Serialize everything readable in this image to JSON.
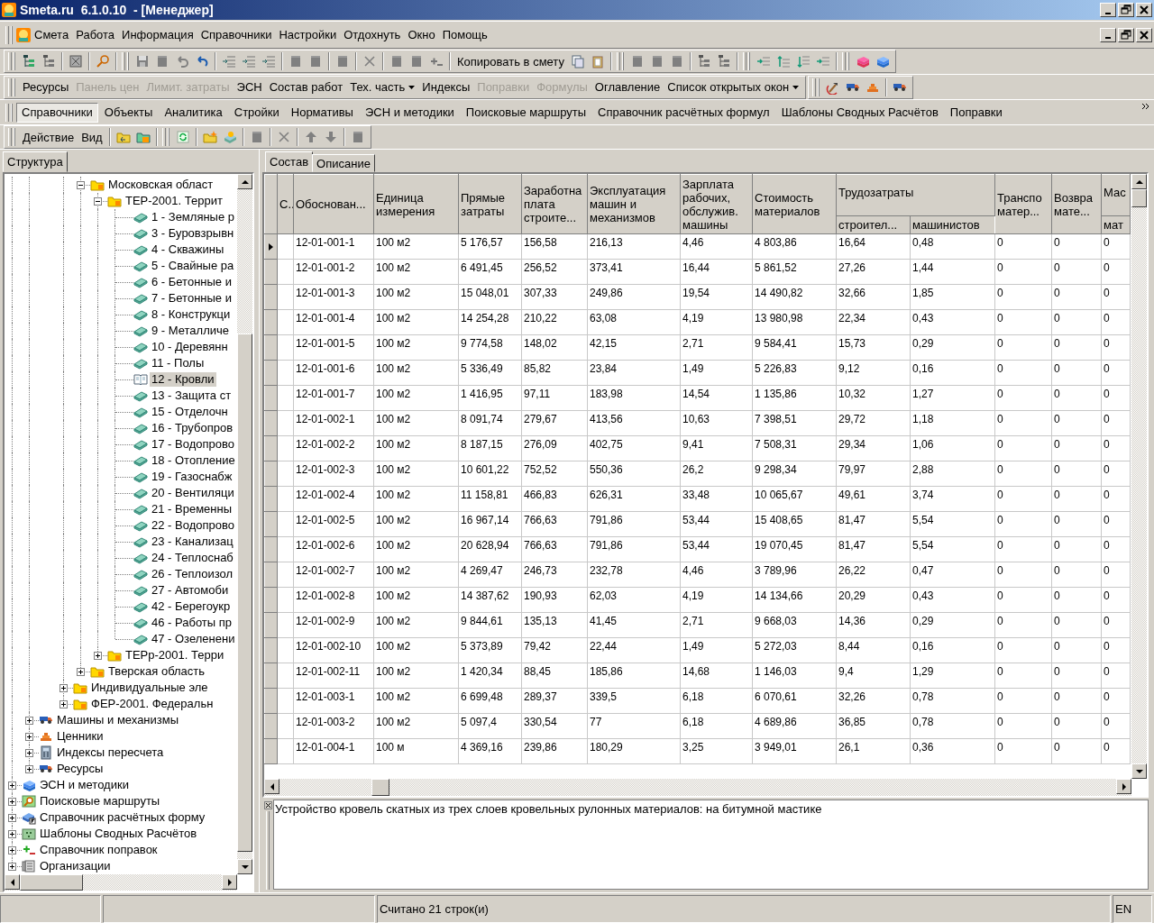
{
  "window": {
    "title": "Smeta.ru  6.1.0.10  - [Менеджер]"
  },
  "menu": [
    "Смета",
    "Работа",
    "Информация",
    "Справочники",
    "Настройки",
    "Отдохнуть",
    "Окно",
    "Помощь"
  ],
  "toolbar": {
    "copy_button": "Копировать в смету"
  },
  "panel_bar": [
    {
      "label": "Ресурсы",
      "disabled": false,
      "kind": "button"
    },
    {
      "label": "Панель цен",
      "disabled": true,
      "kind": "button"
    },
    {
      "label": "Лимит. затраты",
      "disabled": true,
      "kind": "button"
    },
    {
      "label": "ЭСН",
      "disabled": false,
      "kind": "button"
    },
    {
      "label": "Состав работ",
      "disabled": false,
      "kind": "button"
    },
    {
      "label": "Тех. часть",
      "disabled": false,
      "kind": "dropdown"
    },
    {
      "label": "Индексы",
      "disabled": false,
      "kind": "button"
    },
    {
      "label": "Поправки",
      "disabled": true,
      "kind": "button"
    },
    {
      "label": "Формулы",
      "disabled": true,
      "kind": "button"
    },
    {
      "label": "Оглавление",
      "disabled": false,
      "kind": "button"
    },
    {
      "label": "Список открытых окон",
      "disabled": false,
      "kind": "dropdown"
    }
  ],
  "section_tabs": [
    {
      "label": "Справочники",
      "selected": true
    },
    {
      "label": "Объекты",
      "selected": false
    },
    {
      "label": "Аналитика",
      "selected": false
    },
    {
      "label": "Стройки",
      "selected": false
    },
    {
      "label": "Нормативы",
      "selected": false
    },
    {
      "label": "ЭСН и методики",
      "selected": false
    },
    {
      "label": "Поисковые маршруты",
      "selected": false
    },
    {
      "label": "Справочник расчётных формул",
      "selected": false
    },
    {
      "label": "Шаблоны Сводных Расчётов",
      "selected": false
    },
    {
      "label": "Поправки",
      "selected": false
    }
  ],
  "action_menu": [
    "Действие",
    "Вид"
  ],
  "left_panel": {
    "tab": "Структура",
    "tree": [
      {
        "children": [
          {
            "children": [
              {
                "children": [
                  {
                    "children": [
                      {
                        "label": "Московская област",
                        "kind": "folder",
                        "selected": false,
                        "expanded": true,
                        "children": [
                          {
                            "label": "ТЕР-2001. Террит",
                            "kind": "folder",
                            "selected": false,
                            "expanded": true,
                            "children": [
                              {
                                "label": "1 - Земляные р",
                                "kind": "book",
                                "selected": false
                              },
                              {
                                "label": "3 - Буровзрывн",
                                "kind": "book",
                                "selected": false
                              },
                              {
                                "label": "4 - Скважины",
                                "kind": "book",
                                "selected": false
                              },
                              {
                                "label": "5 - Свайные ра",
                                "kind": "book",
                                "selected": false
                              },
                              {
                                "label": "6 - Бетонные и",
                                "kind": "book",
                                "selected": false
                              },
                              {
                                "label": "7 - Бетонные и",
                                "kind": "book",
                                "selected": false
                              },
                              {
                                "label": "8 - Конструкци",
                                "kind": "book",
                                "selected": false
                              },
                              {
                                "label": "9 - Металличе",
                                "kind": "book",
                                "selected": false
                              },
                              {
                                "label": "10 - Деревянн",
                                "kind": "book",
                                "selected": false
                              },
                              {
                                "label": "11 - Полы",
                                "kind": "book",
                                "selected": false
                              },
                              {
                                "label": "12 - Кровли",
                                "kind": "book",
                                "selected": true
                              },
                              {
                                "label": "13 - Защита ст",
                                "kind": "book",
                                "selected": false
                              },
                              {
                                "label": "15 - Отделочн",
                                "kind": "book",
                                "selected": false
                              },
                              {
                                "label": "16 - Трубопров",
                                "kind": "book",
                                "selected": false
                              },
                              {
                                "label": "17 - Водопрово",
                                "kind": "book",
                                "selected": false
                              },
                              {
                                "label": "18 - Отопление",
                                "kind": "book",
                                "selected": false
                              },
                              {
                                "label": "19 - Газоснабж",
                                "kind": "book",
                                "selected": false
                              },
                              {
                                "label": "20 - Вентиляци",
                                "kind": "book",
                                "selected": false
                              },
                              {
                                "label": "21 - Временны",
                                "kind": "book",
                                "selected": false
                              },
                              {
                                "label": "22 - Водопрово",
                                "kind": "book",
                                "selected": false
                              },
                              {
                                "label": "23 - Канализац",
                                "kind": "book",
                                "selected": false
                              },
                              {
                                "label": "24 - Теплоснаб",
                                "kind": "book",
                                "selected": false
                              },
                              {
                                "label": "26 - Теплоизол",
                                "kind": "book",
                                "selected": false
                              },
                              {
                                "label": "27 - Автомоби",
                                "kind": "book",
                                "selected": false
                              },
                              {
                                "label": "42 - Берегоукр",
                                "kind": "book",
                                "selected": false
                              },
                              {
                                "label": "46 - Работы пр",
                                "kind": "book",
                                "selected": false
                              },
                              {
                                "label": "47 - Озеленени",
                                "kind": "book",
                                "selected": false
                              }
                            ]
                          },
                          {
                            "label": "ТЕРр-2001. Терри",
                            "kind": "folder",
                            "selected": false,
                            "expanded": false
                          }
                        ]
                      },
                      {
                        "label": "Тверская область",
                        "kind": "folder",
                        "selected": false,
                        "expanded": false
                      }
                    ]
                  },
                  {
                    "label": "Индивидуальные эле",
                    "kind": "folder",
                    "selected": false,
                    "expanded": false
                  },
                  {
                    "label": "ФЕР-2001. Федеральн",
                    "kind": "folder",
                    "selected": false,
                    "expanded": false
                  }
                ]
              }
            ]
          },
          {
            "label": "Машины и механизмы",
            "kind": "truck",
            "selected": false,
            "expanded": false
          },
          {
            "label": "Ценники",
            "kind": "bricks",
            "selected": false,
            "expanded": false
          },
          {
            "label": "Индексы пересчета",
            "kind": "calculator",
            "selected": false,
            "expanded": false
          },
          {
            "label": "Ресурсы",
            "kind": "truck",
            "selected": false,
            "expanded": false
          }
        ]
      },
      {
        "label": "ЭСН и методики",
        "kind": "books",
        "selected": false,
        "expanded": false
      },
      {
        "label": "Поисковые маршруты",
        "kind": "map",
        "selected": false,
        "expanded": false
      },
      {
        "label": "Справочник расчётных форму",
        "kind": "formula",
        "selected": false,
        "expanded": false
      },
      {
        "label": "Шаблоны Сводных Расчётов",
        "kind": "template",
        "selected": false,
        "expanded": false
      },
      {
        "label": "Справочник поправок",
        "kind": "plusminus",
        "selected": false,
        "expanded": false
      },
      {
        "label": "Организации",
        "kind": "organizer",
        "selected": false,
        "expanded": false
      }
    ]
  },
  "right_panel": {
    "tabs": [
      {
        "label": "Состав",
        "selected": true
      },
      {
        "label": "Описание",
        "selected": false
      }
    ],
    "table": {
      "columns": [
        {
          "label": "С.."
        },
        {
          "label": "Обоснован..."
        },
        {
          "label": "Единица\nизмерения"
        },
        {
          "label": "Прямые\nзатраты"
        },
        {
          "label": "Заработна\nплата\nстроите..."
        },
        {
          "label": "Эксплуатация\nмашин и\nмеханизмов"
        },
        {
          "label": "Зарплата\nрабочих,\nобслужив.\nмашины"
        },
        {
          "label": "Стоимость\nматериалов"
        },
        {
          "label": "Трудозатраты",
          "colspan": 2,
          "sub": [
            "строител...",
            "машинистов"
          ]
        },
        {
          "label": "Транспо\nматер..."
        },
        {
          "label": "Возвра\nмате..."
        },
        {
          "label": "Мас",
          "sub": [
            "мат"
          ]
        }
      ],
      "rows": [
        {
          "selected": true,
          "cells": [
            "",
            "12-01-001-1",
            "100 м2",
            "5 176,57",
            "156,58",
            "216,13",
            "4,46",
            "4 803,86",
            "16,64",
            "0,48",
            "0",
            "0",
            "0"
          ]
        },
        {
          "selected": false,
          "cells": [
            "",
            "12-01-001-2",
            "100 м2",
            "6 491,45",
            "256,52",
            "373,41",
            "16,44",
            "5 861,52",
            "27,26",
            "1,44",
            "0",
            "0",
            "0"
          ]
        },
        {
          "selected": false,
          "cells": [
            "",
            "12-01-001-3",
            "100 м2",
            "15 048,01",
            "307,33",
            "249,86",
            "19,54",
            "14 490,82",
            "32,66",
            "1,85",
            "0",
            "0",
            "0"
          ]
        },
        {
          "selected": false,
          "cells": [
            "",
            "12-01-001-4",
            "100 м2",
            "14 254,28",
            "210,22",
            "63,08",
            "4,19",
            "13 980,98",
            "22,34",
            "0,43",
            "0",
            "0",
            "0"
          ]
        },
        {
          "selected": false,
          "cells": [
            "",
            "12-01-001-5",
            "100 м2",
            "9 774,58",
            "148,02",
            "42,15",
            "2,71",
            "9 584,41",
            "15,73",
            "0,29",
            "0",
            "0",
            "0"
          ]
        },
        {
          "selected": false,
          "cells": [
            "",
            "12-01-001-6",
            "100 м2",
            "5 336,49",
            "85,82",
            "23,84",
            "1,49",
            "5 226,83",
            "9,12",
            "0,16",
            "0",
            "0",
            "0"
          ]
        },
        {
          "selected": false,
          "cells": [
            "",
            "12-01-001-7",
            "100 м2",
            "1 416,95",
            "97,11",
            "183,98",
            "14,54",
            "1 135,86",
            "10,32",
            "1,27",
            "0",
            "0",
            "0"
          ]
        },
        {
          "selected": false,
          "cells": [
            "",
            "12-01-002-1",
            "100 м2",
            "8 091,74",
            "279,67",
            "413,56",
            "10,63",
            "7 398,51",
            "29,72",
            "1,18",
            "0",
            "0",
            "0"
          ]
        },
        {
          "selected": false,
          "cells": [
            "",
            "12-01-002-2",
            "100 м2",
            "8 187,15",
            "276,09",
            "402,75",
            "9,41",
            "7 508,31",
            "29,34",
            "1,06",
            "0",
            "0",
            "0"
          ]
        },
        {
          "selected": false,
          "cells": [
            "",
            "12-01-002-3",
            "100 м2",
            "10 601,22",
            "752,52",
            "550,36",
            "26,2",
            "9 298,34",
            "79,97",
            "2,88",
            "0",
            "0",
            "0"
          ]
        },
        {
          "selected": false,
          "cells": [
            "",
            "12-01-002-4",
            "100 м2",
            "11 158,81",
            "466,83",
            "626,31",
            "33,48",
            "10 065,67",
            "49,61",
            "3,74",
            "0",
            "0",
            "0"
          ]
        },
        {
          "selected": false,
          "cells": [
            "",
            "12-01-002-5",
            "100 м2",
            "16 967,14",
            "766,63",
            "791,86",
            "53,44",
            "15 408,65",
            "81,47",
            "5,54",
            "0",
            "0",
            "0"
          ]
        },
        {
          "selected": false,
          "cells": [
            "",
            "12-01-002-6",
            "100 м2",
            "20 628,94",
            "766,63",
            "791,86",
            "53,44",
            "19 070,45",
            "81,47",
            "5,54",
            "0",
            "0",
            "0"
          ]
        },
        {
          "selected": false,
          "cells": [
            "",
            "12-01-002-7",
            "100 м2",
            "4 269,47",
            "246,73",
            "232,78",
            "4,46",
            "3 789,96",
            "26,22",
            "0,47",
            "0",
            "0",
            "0"
          ]
        },
        {
          "selected": false,
          "cells": [
            "",
            "12-01-002-8",
            "100 м2",
            "14 387,62",
            "190,93",
            "62,03",
            "4,19",
            "14 134,66",
            "20,29",
            "0,43",
            "0",
            "0",
            "0"
          ]
        },
        {
          "selected": false,
          "cells": [
            "",
            "12-01-002-9",
            "100 м2",
            "9 844,61",
            "135,13",
            "41,45",
            "2,71",
            "9 668,03",
            "14,36",
            "0,29",
            "0",
            "0",
            "0"
          ]
        },
        {
          "selected": false,
          "cells": [
            "",
            "12-01-002-10",
            "100 м2",
            "5 373,89",
            "79,42",
            "22,44",
            "1,49",
            "5 272,03",
            "8,44",
            "0,16",
            "0",
            "0",
            "0"
          ]
        },
        {
          "selected": false,
          "cells": [
            "",
            "12-01-002-11",
            "100 м2",
            "1 420,34",
            "88,45",
            "185,86",
            "14,68",
            "1 146,03",
            "9,4",
            "1,29",
            "0",
            "0",
            "0"
          ]
        },
        {
          "selected": false,
          "cells": [
            "",
            "12-01-003-1",
            "100 м2",
            "6 699,48",
            "289,37",
            "339,5",
            "6,18",
            "6 070,61",
            "32,26",
            "0,78",
            "0",
            "0",
            "0"
          ]
        },
        {
          "selected": false,
          "cells": [
            "",
            "12-01-003-2",
            "100 м2",
            "5 097,4",
            "330,54",
            "77",
            "6,18",
            "4 689,86",
            "36,85",
            "0,78",
            "0",
            "0",
            "0"
          ]
        },
        {
          "selected": false,
          "cells": [
            "",
            "12-01-004-1",
            "100 м",
            "4 369,16",
            "239,86",
            "180,29",
            "3,25",
            "3 949,01",
            "26,1",
            "0,36",
            "0",
            "0",
            "0"
          ]
        }
      ]
    },
    "description": "Устройство кровель скатных из трех слоев кровельных рулонных материалов: на битумной мастике"
  },
  "status_bar": {
    "message": "Считано 21 строк(и)",
    "language": "EN"
  }
}
